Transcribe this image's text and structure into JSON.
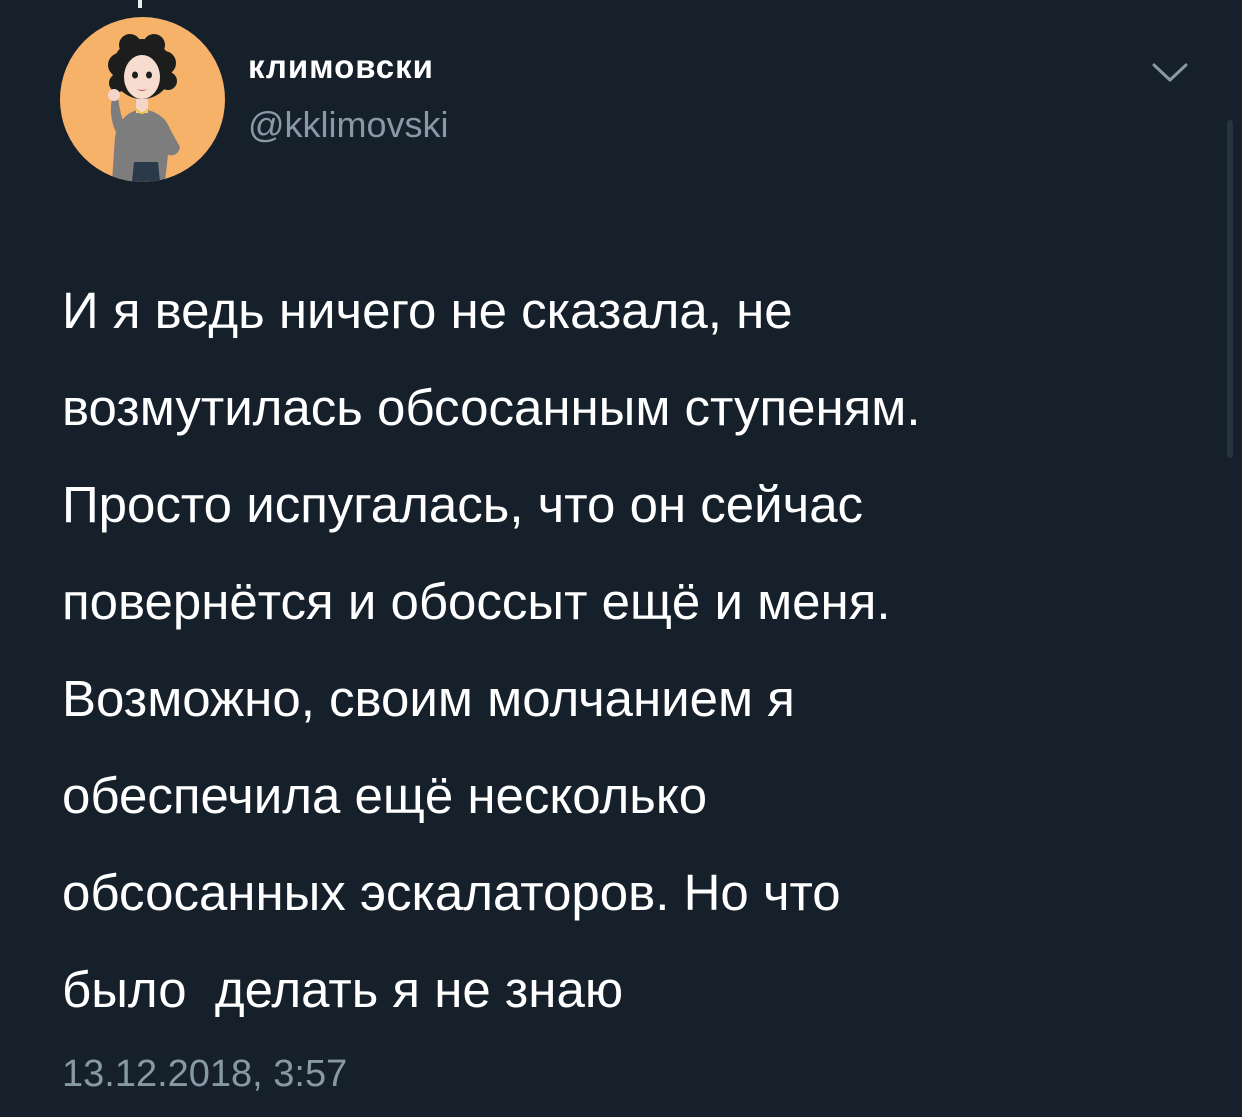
{
  "author": {
    "display_name": "климовски",
    "handle": "@kklimovski",
    "avatar_icon": "avatar-illustration",
    "avatar_bg": "#f7b26a"
  },
  "menu_icon": "chevron-down-icon",
  "tweet": {
    "lines": [
      "И я ведь ничего не сказала, не",
      "возмутилась обсосанным ступеням.",
      "Просто испугалась, что он сейчас",
      "повернётся и обоссыт ещё и меня.",
      "Возможно, своим молчанием я",
      "обеспечила ещё несколько",
      "обсосанных эскалаторов. Но что",
      "было  делать я не знаю"
    ],
    "timestamp": "13.12.2018, 3:57"
  },
  "colors": {
    "background": "#15202b",
    "text": "#ffffff",
    "secondary_text": "#8899a6"
  }
}
